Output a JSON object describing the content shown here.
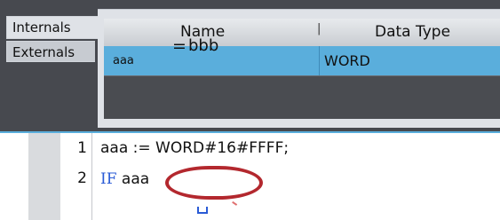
{
  "tabs": [
    {
      "label": "Internals",
      "active": true
    },
    {
      "label": "Externals",
      "active": false
    }
  ],
  "table": {
    "columns": [
      "Name",
      "Data Type"
    ],
    "rows": [
      {
        "name": "aaa",
        "data_type": "WORD"
      }
    ]
  },
  "editor": {
    "lines": [
      {
        "number": "1",
        "code": "aaa := WORD#16#FFFF;"
      },
      {
        "number": "2",
        "keyword": "IF",
        "var": "aaa",
        "operator": "=",
        "operand": "bbb"
      }
    ]
  },
  "colors": {
    "panel_bg": "#47494f",
    "selected_row": "#5aaedc",
    "keyword": "#2a5bd6",
    "annotation": "#b3282e"
  }
}
